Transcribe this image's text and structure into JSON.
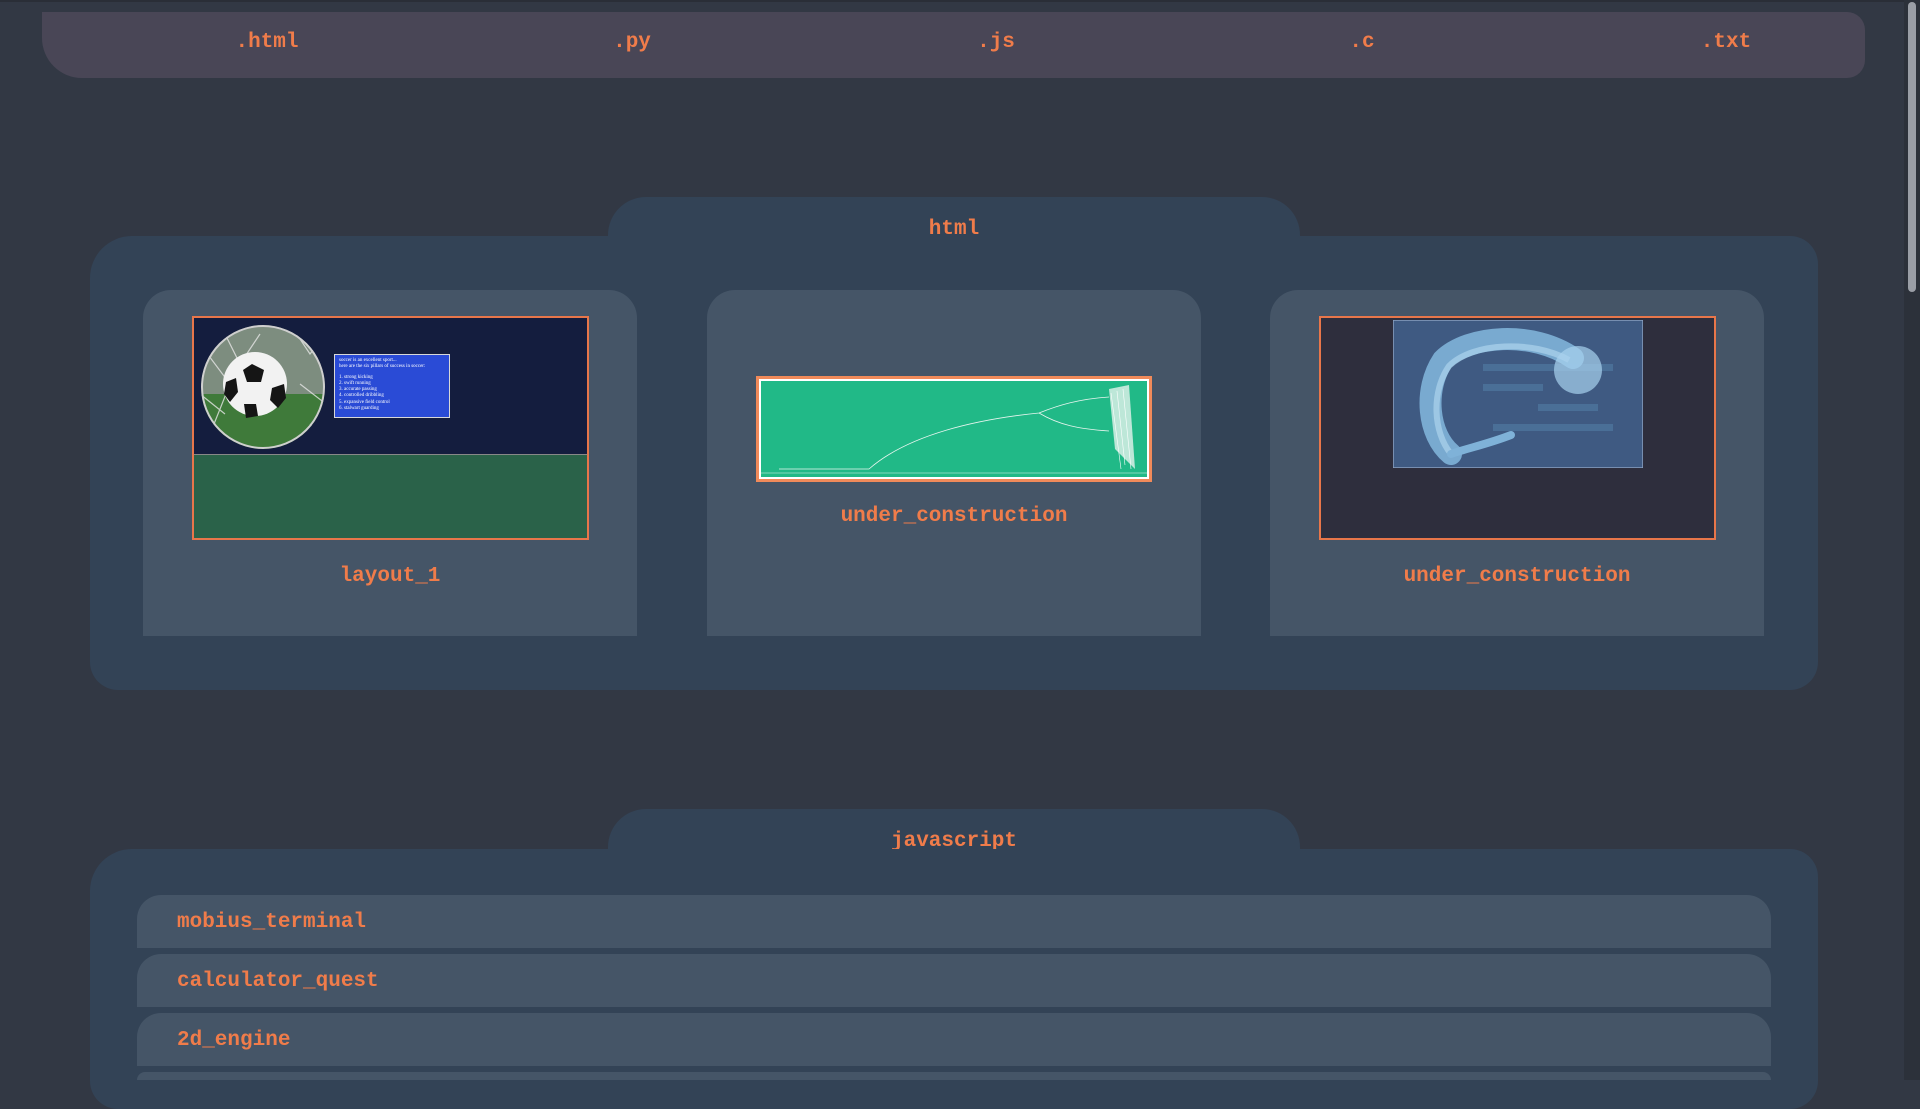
{
  "nav": {
    "links": [
      ".html",
      ".py",
      ".js",
      ".c",
      ".txt"
    ]
  },
  "html_section": {
    "title": "html",
    "cards": [
      {
        "label": "layout_1",
        "thumb_text": {
          "lines": [
            "soccer is an excellent sport...",
            "here are the six pillars of success in soccer:"
          ],
          "items": [
            "1. strong kicking",
            "2. swift running",
            "3. accurate passing",
            "4. controlled dribbling",
            "5. expansive field control",
            "6. stalwart guarding"
          ]
        }
      },
      {
        "label": "under_construction"
      },
      {
        "label": "under_construction"
      }
    ]
  },
  "js_section": {
    "title": "javascript",
    "items": [
      "mobius_terminal",
      "calculator_quest",
      "2d_engine"
    ]
  },
  "colors": {
    "background": "#323844",
    "accent": "#f07c4a",
    "panel": "#334356",
    "card": "#455567",
    "nav": "#494656"
  }
}
